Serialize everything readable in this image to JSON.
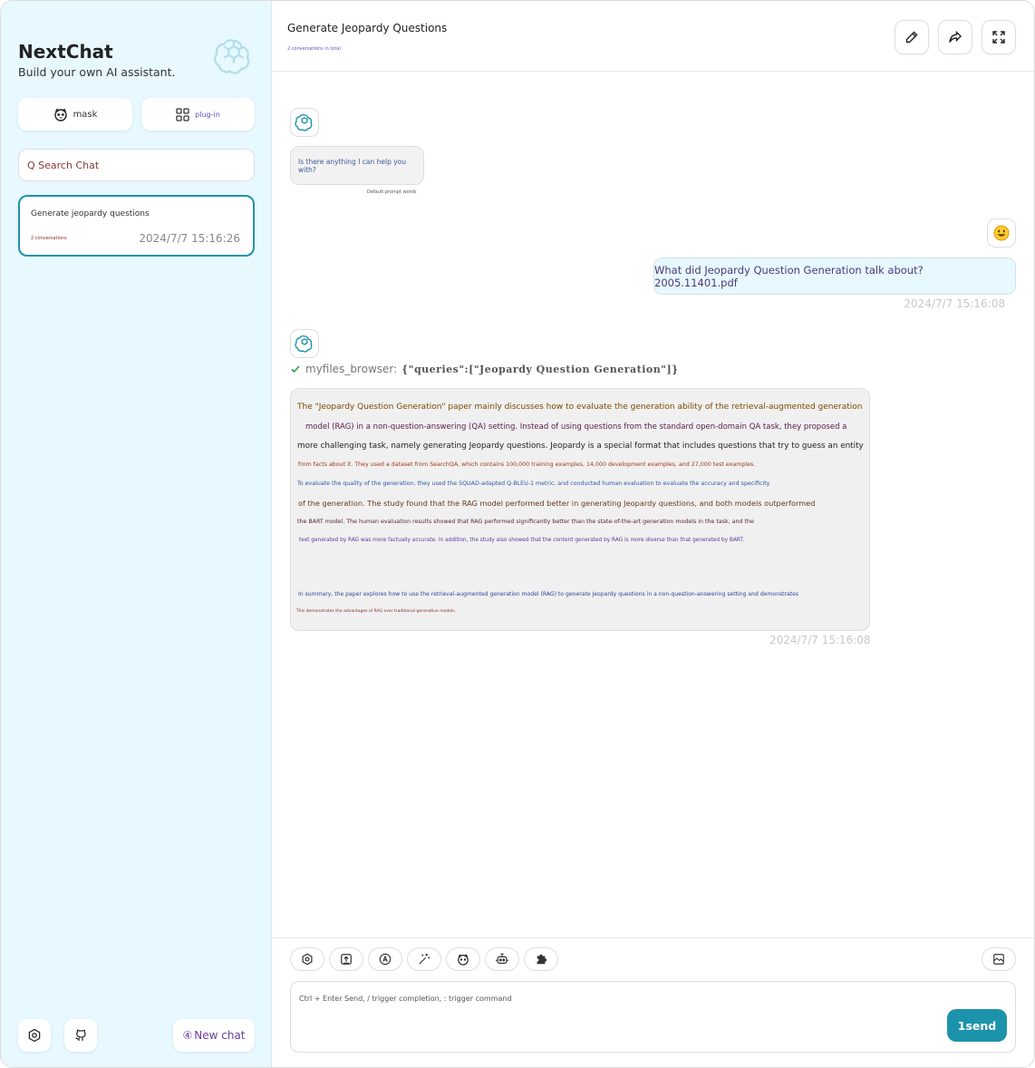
{
  "sidebar": {
    "title": "NextChat",
    "subtitle": "Build your own AI assistant.",
    "mask_label": "mask",
    "plugin_label": "plug-in",
    "search_placeholder": "Q Search Chat",
    "chats": [
      {
        "title": "Generate jeopardy questions",
        "count": "2 conversations",
        "date": "2024/7/7 15:16:26"
      }
    ],
    "new_chat_label": "New chat",
    "new_chat_prefix": "④"
  },
  "header": {
    "title": "Generate Jeopardy Questions",
    "subtitle": "2 conversations in total"
  },
  "messages": {
    "system_text": "Is there anything I can help you with?",
    "system_note": "Default prompt words",
    "user_text": "What did Jeopardy Question Generation talk about? 2005.11401.pdf",
    "user_date": "2024/7/7 15:16:08",
    "tool_name": "myfiles_browser:",
    "tool_query": "{\"queries\":[\"Jeopardy Question Generation\"]}",
    "bot_lines": [
      "The \"Jeopardy Question Generation\" paper mainly discusses how to evaluate the generation ability of the retrieval-augmented generation",
      "model (RAG) in a non-question-answering (QA) setting. Instead of using questions from the standard open-domain QA task, they proposed a",
      "more challenging task, namely generating Jeopardy questions. Jeopardy is a special format that includes questions that try to guess an entity",
      "from facts about it. They used a dataset from SearchQA, which contains 100,000 training examples, 14,000 development examples, and 27,000 test examples.",
      "To evaluate the quality of the generation, they used the SQUAD-adapted Q-BLEU-1 metric, and conducted human evaluation to evaluate the accuracy and specificity",
      "of the generation. The study found that the RAG model performed better in generating Jeopardy questions, and both models outperformed",
      "the BART model. The human evaluation results showed that RAG performed significantly better than the state-of-the-art generation models in the task, and the",
      "text generated by RAG was more factually accurate. In addition, the study also showed that the content generated by RAG is more diverse than that generated by BART.",
      "In summary, the paper explores how to use the retrieval-augmented generation model (RAG) to generate Jeopardy questions in a non-question-answering setting and demonstrates",
      "This demonstrates the advantages of RAG over traditional generative models."
    ],
    "bot_date": "2024/7/7 15:16:08"
  },
  "input": {
    "placeholder": "Ctrl + Enter Send, / trigger completion, : trigger command",
    "send_label": "1send"
  },
  "colors": {
    "accent": "#1d93ab",
    "sidebar_bg": "#e7f8ff",
    "user_bubble": "#e7f8ff",
    "bot_bubble": "#f0f0f0"
  },
  "icons": [
    "openai-logo-icon",
    "mask-icon",
    "plugin-grid-icon",
    "edit-icon",
    "share-icon",
    "fullscreen-icon",
    "settings-icon",
    "github-icon",
    "smiley-icon",
    "check-icon",
    "upload-icon",
    "text-icon",
    "magic-wand-icon",
    "robot-icon",
    "puzzle-icon",
    "image-icon"
  ]
}
